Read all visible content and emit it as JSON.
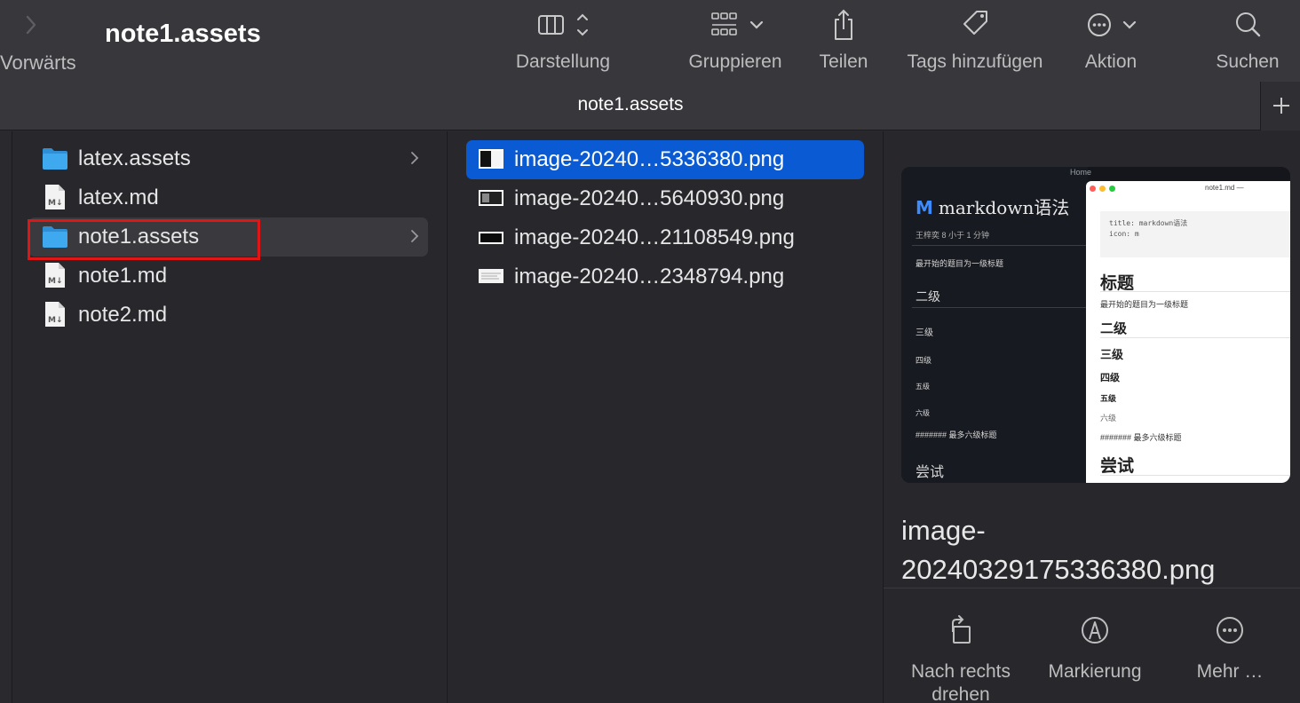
{
  "toolbar": {
    "forward_label": "Vorwärts",
    "window_title": "note1.assets",
    "items": [
      {
        "label": "Darstellung",
        "icon": "columns-view-icon"
      },
      {
        "label": "Gruppieren",
        "icon": "group-grid-icon"
      },
      {
        "label": "Teilen",
        "icon": "share-icon"
      },
      {
        "label": "Tags hinzufügen",
        "icon": "tag-icon"
      },
      {
        "label": "Aktion",
        "icon": "ellipsis-circle-icon"
      },
      {
        "label": "Suchen",
        "icon": "search-icon"
      }
    ]
  },
  "tabbar": {
    "title": "note1.assets",
    "add_icon": "plus-icon"
  },
  "column1": {
    "items": [
      {
        "label": "latex.assets",
        "type": "folder"
      },
      {
        "label": "latex.md",
        "type": "markdown"
      },
      {
        "label": "note1.assets",
        "type": "folder"
      },
      {
        "label": "note1.md",
        "type": "markdown"
      },
      {
        "label": "note2.md",
        "type": "markdown"
      }
    ]
  },
  "column2": {
    "items": [
      {
        "label": "image-20240…5336380.png"
      },
      {
        "label": "image-20240…5640930.png"
      },
      {
        "label": "image-20240…21108549.png"
      },
      {
        "label": "image-20240…2348794.png"
      }
    ]
  },
  "preview": {
    "thumbnail": {
      "crumb": "Home",
      "dark_title_mark": "M",
      "dark_title": "markdown语法",
      "dark_meta": "王梓奕  8  小于 1 分钟",
      "dark_lines": [
        "最开始的题目为一级标题",
        "二级",
        "三级",
        "四级",
        "五级",
        "六级",
        "####### 最多六级标题",
        "尝试"
      ],
      "light_window_title": "note1.md —",
      "code_lines": "title: markdown语法\nicon: m",
      "light_lines": [
        "标题",
        "最开始的题目为一级标题",
        "二级",
        "三级",
        "四级",
        "五级",
        "六级",
        "####### 最多六级标题",
        "尝试"
      ]
    },
    "filename": "image-20240329175336380.png",
    "actions": [
      {
        "label": "Nach rechts drehen",
        "icon": "rotate-right-icon"
      },
      {
        "label": "Markierung",
        "icon": "markup-icon"
      },
      {
        "label": "Mehr …",
        "icon": "more-icon"
      }
    ]
  },
  "colors": {
    "selection": "#0a5bd3",
    "folder": "#3fa9f0",
    "highlight_box": "#e01616"
  }
}
